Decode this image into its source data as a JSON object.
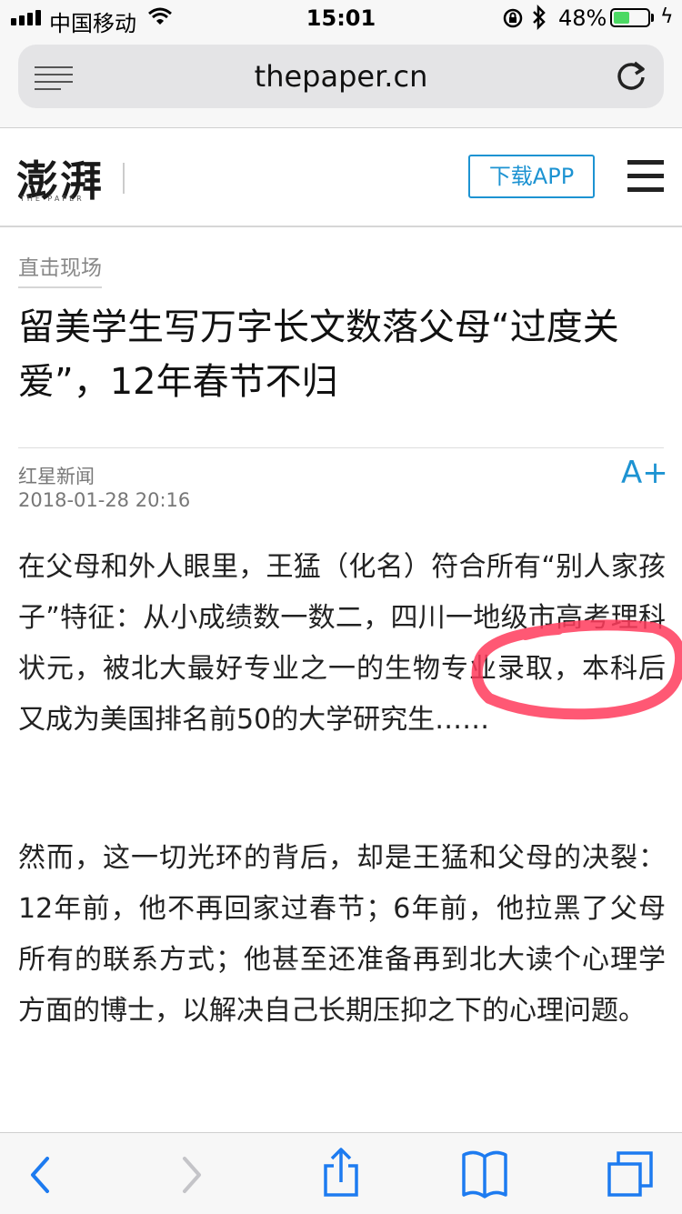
{
  "status_bar": {
    "carrier": "中国移动",
    "time": "15:01",
    "battery_percent_text": "48%",
    "battery_level": 0.48,
    "battery_color": "#4cd964"
  },
  "browser": {
    "domain": "thepaper.cn"
  },
  "site_header": {
    "logo_text": "澎湃",
    "logo_subtitle": "THE PAPER",
    "download_label": "下载APP",
    "accent_color": "#1d93d2"
  },
  "article": {
    "category": "直击现场",
    "title": "留美学生写万字长文数落父母“过度关爱”，12年春节不归",
    "source": "红星新闻",
    "datetime": "2018-01-28 20:16",
    "font_size_button": "A+",
    "paragraphs": [
      "在父母和外人眼里，王猛（化名）符合所有“别人家孩子”特征：从小成绩数一数二，四川一地级市高考理科状元，被北大最好专业之一的生物专业录取，本科后又成为美国排名前50的大学研究生……",
      "然而，这一切光环的背后，却是王猛和父母的决裂：12年前，他不再回家过春节；6年前，他拉黑了父母所有的联系方式；他甚至还准备再到北大读个心理学方面的博士，以解决自己长期压抑之下的心理问题。"
    ]
  },
  "annotation": {
    "color": "#ff3b5c"
  },
  "toolbar_icons": [
    "back-icon",
    "forward-icon",
    "share-icon",
    "bookmarks-icon",
    "tabs-icon"
  ]
}
